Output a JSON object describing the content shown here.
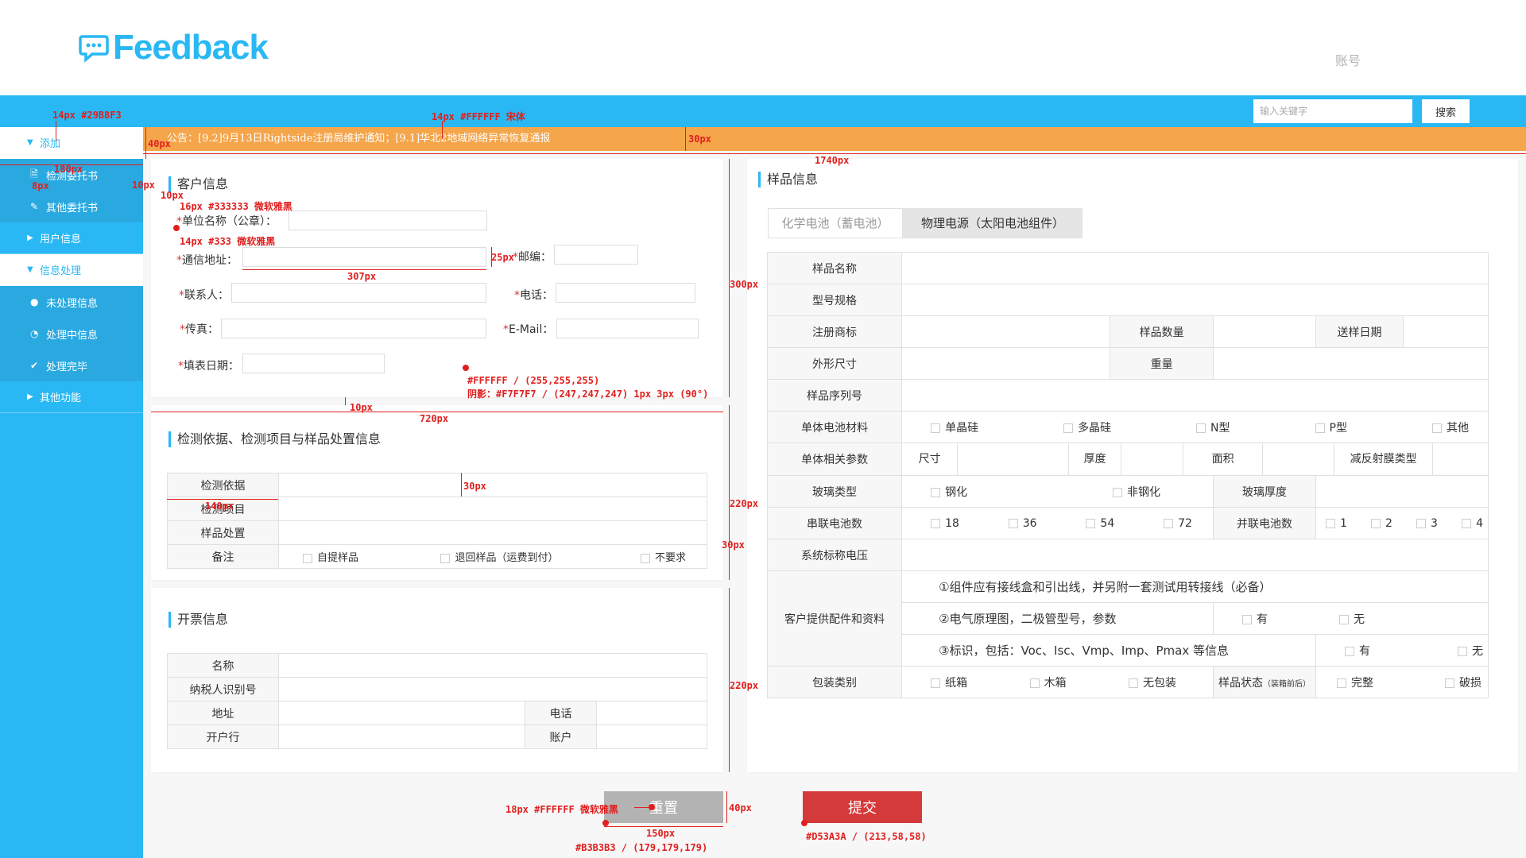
{
  "header": {
    "logo_text": "Feedback",
    "account_label": "账号"
  },
  "search": {
    "placeholder": "输入关键字",
    "button_label": "搜索"
  },
  "notice": {
    "text": "公告：[9.2]9月13日Rightside注册局维护通知；[9.1]华北2地域网络异常恢复通报"
  },
  "sidebar": {
    "items": [
      {
        "label": "添加",
        "arrow": "▼"
      },
      {
        "label": "检测委托书",
        "icon": "🗎"
      },
      {
        "label": "其他委托书",
        "icon": "✎"
      },
      {
        "label": "用户信息",
        "arrow": "▶"
      },
      {
        "label": "信息处理",
        "arrow": "▼"
      },
      {
        "label": "未处理信息",
        "icon": "●"
      },
      {
        "label": "处理中信息",
        "icon": "◔"
      },
      {
        "label": "处理完毕",
        "icon": "✔"
      },
      {
        "label": "其他功能",
        "arrow": "▶"
      }
    ]
  },
  "customer": {
    "title": "客户信息",
    "company": "单位名称（公章）：",
    "address": "通信地址：",
    "zip": "邮编：",
    "contact": "联系人：",
    "phone": "电话：",
    "fax": "传真：",
    "email": "E-Mail：",
    "date": "填表日期："
  },
  "basis": {
    "title": "检测依据、检测项目与样品处置信息",
    "rows": [
      "检测依据",
      "检测项目",
      "样品处置",
      "备注"
    ],
    "options": [
      "自提样品",
      "退回样品（运费到付）",
      "不要求"
    ]
  },
  "invoice": {
    "title": "开票信息",
    "name": "名称",
    "taxid": "纳税人识别号",
    "address": "地址",
    "phone": "电话",
    "bank": "开户行",
    "account": "账户"
  },
  "sample": {
    "title": "样品信息",
    "tabs": [
      "化学电池（蓄电池）",
      "物理电源（太阳电池组件）"
    ],
    "name": "样品名称",
    "model": "型号规格",
    "trademark": "注册商标",
    "quantity": "样品数量",
    "send_date": "送样日期",
    "size": "外形尺寸",
    "weight": "重量",
    "serial": "样品序列号",
    "material": "单体电池材料",
    "materials": [
      "单晶硅",
      "多晶硅",
      "N型",
      "P型",
      "其他"
    ],
    "params": "单体相关参数",
    "param_items": [
      "尺寸",
      "厚度",
      "面积",
      "减反射膜类型"
    ],
    "glass": "玻璃类型",
    "glass_opts": [
      "钢化",
      "非钢化"
    ],
    "glass_thick": "玻璃厚度",
    "series": "串联电池数",
    "series_opts": [
      "18",
      "36",
      "54",
      "72"
    ],
    "parallel": "并联电池数",
    "parallel_opts": [
      "1",
      "2",
      "3",
      "4"
    ],
    "voltage": "系统标称电压",
    "accessories": "客户提供配件和资料",
    "acc1": "①组件应有接线盒和引出线，并另附一套测试用转接线（必备）",
    "acc2": "②电气原理图，二极管型号，参数",
    "acc3": "③标识，包括：Voc、Isc、Vmp、Imp、Pmax 等信息",
    "yes": "有",
    "no": "无",
    "package": "包装类别",
    "package_opts": [
      "纸箱",
      "木箱",
      "无包装"
    ],
    "state": "样品状态",
    "state_note": "（装箱前后）",
    "state_opts": [
      "完整",
      "破损"
    ]
  },
  "buttons": {
    "reset": "重置",
    "submit": "提交"
  },
  "annotations": [
    "14px #29B8F3",
    "14px #FFFFFF 宋体",
    "40px",
    "30px",
    "1740px",
    "180px",
    "8px",
    "10px",
    "10px",
    "16px #333333 微软雅黑",
    "14px #333 微软雅黑",
    "25px",
    "307px",
    "300px",
    "#FFFFFF / (255,255,255)",
    "阴影：#F7F7F7 / (247,247,247) 1px 3px (90°)",
    "10px",
    "720px",
    "30px",
    "140px",
    "220px",
    "30px",
    "220px",
    "18px #FFFFFF 微软雅黑",
    "40px",
    "150px",
    "#B3B3B3 / (179,179,179)",
    "#D53A3A / (213,58,58)"
  ],
  "colors": {
    "primary": "#29b8f3",
    "notice": "#f5a54a",
    "reset": "#b3b3b3",
    "submit": "#d53a3a",
    "annotation": "#e0201f"
  }
}
